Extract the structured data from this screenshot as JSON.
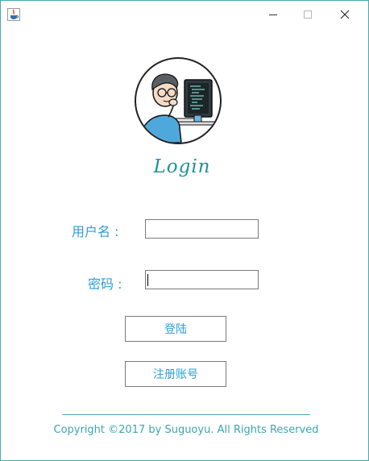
{
  "window": {
    "icon": "java-cup-icon",
    "controls": {
      "minimize": "minimize-icon",
      "maximize": "maximize-icon",
      "close": "close-icon"
    }
  },
  "logo": {
    "text": "Login",
    "color": "#1f8f9e"
  },
  "form": {
    "username_label": "用户名 :",
    "password_label": "密码 :",
    "username_value": "",
    "password_value": ""
  },
  "buttons": {
    "login": "登陆",
    "register": "注册账号"
  },
  "footer": {
    "copyright": "Copyright ©2017 by Suguoyu. All Rights Reserved"
  },
  "colors": {
    "accent": "#2d9fd6",
    "teal": "#4aa7b0"
  }
}
